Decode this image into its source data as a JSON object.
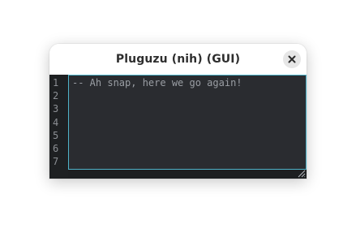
{
  "window": {
    "title": "Pluguzu (nih) (GUI)",
    "close_icon": "close-icon"
  },
  "editor": {
    "line_numbers": [
      "1",
      "2",
      "3",
      "4",
      "5",
      "6",
      "7"
    ],
    "lines": [
      "-- Ah snap, here we go again!",
      "",
      "",
      "",
      "",
      "",
      ""
    ],
    "resize_icon": "resize-grip-icon"
  },
  "colors": {
    "editor_bg": "#2a2c30",
    "gutter_bg": "#1e2022",
    "focus_border": "#4fb3c9",
    "comment_text": "#9a9ea4"
  }
}
